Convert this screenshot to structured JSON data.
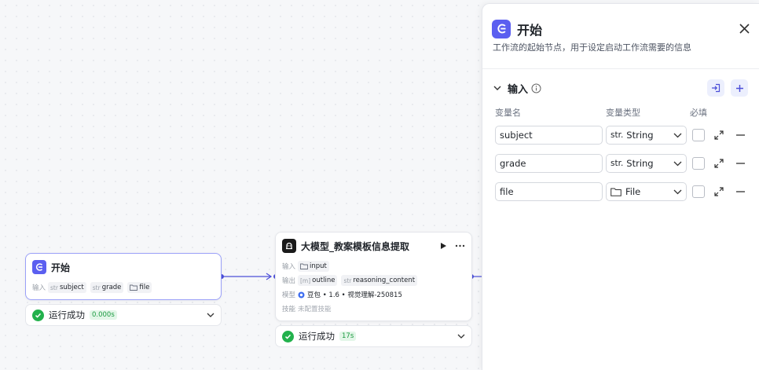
{
  "start_node": {
    "title": "开始",
    "input_label": "输入",
    "params": [
      {
        "type": "str",
        "name": "subject"
      },
      {
        "type": "str",
        "name": "grade"
      },
      {
        "type": "file-icon",
        "name": "file"
      }
    ]
  },
  "start_run": {
    "status": "运行成功",
    "time": "0.000s"
  },
  "llm_node": {
    "title": "大模型_教案模板信息提取",
    "input_label": "输入",
    "input_param": "input",
    "output_label": "输出",
    "outputs": [
      {
        "type": "[m]",
        "name": "outline"
      },
      {
        "type": "str",
        "name": "reasoning_content"
      }
    ],
    "model_label": "模型",
    "model_value": "豆包 • 1.6 • 视觉理解-250815",
    "skill_label": "技能",
    "skill_value": "未配置技能"
  },
  "llm_run": {
    "status": "运行成功",
    "time": "17s"
  },
  "panel": {
    "title": "开始",
    "description": "工作流的起始节点，用于设定启动工作流需要的信息",
    "section_title": "输入",
    "columns": [
      "变量名",
      "变量类型",
      "必填"
    ],
    "variables": [
      {
        "name": "subject",
        "type_prefix": "str.",
        "type": "String"
      },
      {
        "name": "grade",
        "type_prefix": "str.",
        "type": "String"
      },
      {
        "name": "file",
        "type_prefix": "",
        "type": "File"
      }
    ]
  },
  "colors": {
    "accent": "#5b5ff0",
    "success": "#22b14c",
    "edge": "#4c4fd8"
  }
}
